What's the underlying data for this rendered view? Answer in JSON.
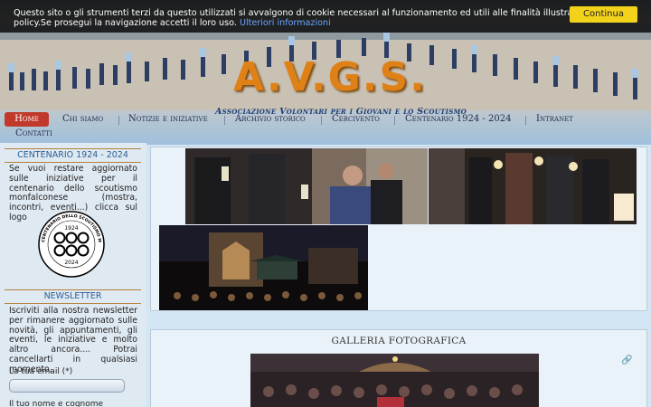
{
  "cookie": {
    "message": "Questo sito o gli strumenti terzi da questo utilizzati si avvalgono di cookie necessari al funzionamento ed utili alle finalità illustrate nella cookie policy.Se prosegui la navigazione accetti il loro uso.",
    "link_label": "Ulteriori informazioni",
    "button_label": "Continua"
  },
  "header": {
    "logo_text": "A.V.G.S.",
    "tagline": "Associazione Volontari per i Giovani e lo Scoutismo"
  },
  "nav": {
    "items": [
      {
        "label": "Home"
      },
      {
        "label": "Chi siamo"
      },
      {
        "label": "Notizie e iniziative"
      },
      {
        "label": "Archivio storico"
      },
      {
        "label": "Cercivento"
      },
      {
        "label": "Centenario 1924 - 2024"
      },
      {
        "label": "Intranet"
      },
      {
        "label": "Contatti"
      }
    ]
  },
  "sidebar": {
    "centenario": {
      "title": "CENTENARIO 1924 - 2024",
      "text": "Se vuoi restare aggiornato sulle iniziative per il centenario dello scoutismo monfalconese (mostra, incontri, eventi...) clicca sul logo",
      "badge_text": "CENTENARIO DELLO SCOUTISMO MONFALCONESE",
      "badge_year_top": "1924",
      "badge_year_bottom": "2024"
    },
    "newsletter": {
      "title": "NEWSLETTER",
      "text": "Iscriviti alla nostra newsletter per rimanere aggiornato sulle novità, gli appuntamenti, gli eventi, le iniziative e molto altro ancora.... Potrai cancellarti in qualsiasi momento.",
      "email_label": "La tua email (*)",
      "name_label": "Il tuo nome e cognome"
    }
  },
  "gallery": {
    "title": "GALLERIA FOTOGRAFICA"
  },
  "colors": {
    "accent_orange": "#e08118",
    "nav_active": "#c0392b",
    "cookie_button": "#f2d21a",
    "link_blue": "#6ba4ff"
  }
}
